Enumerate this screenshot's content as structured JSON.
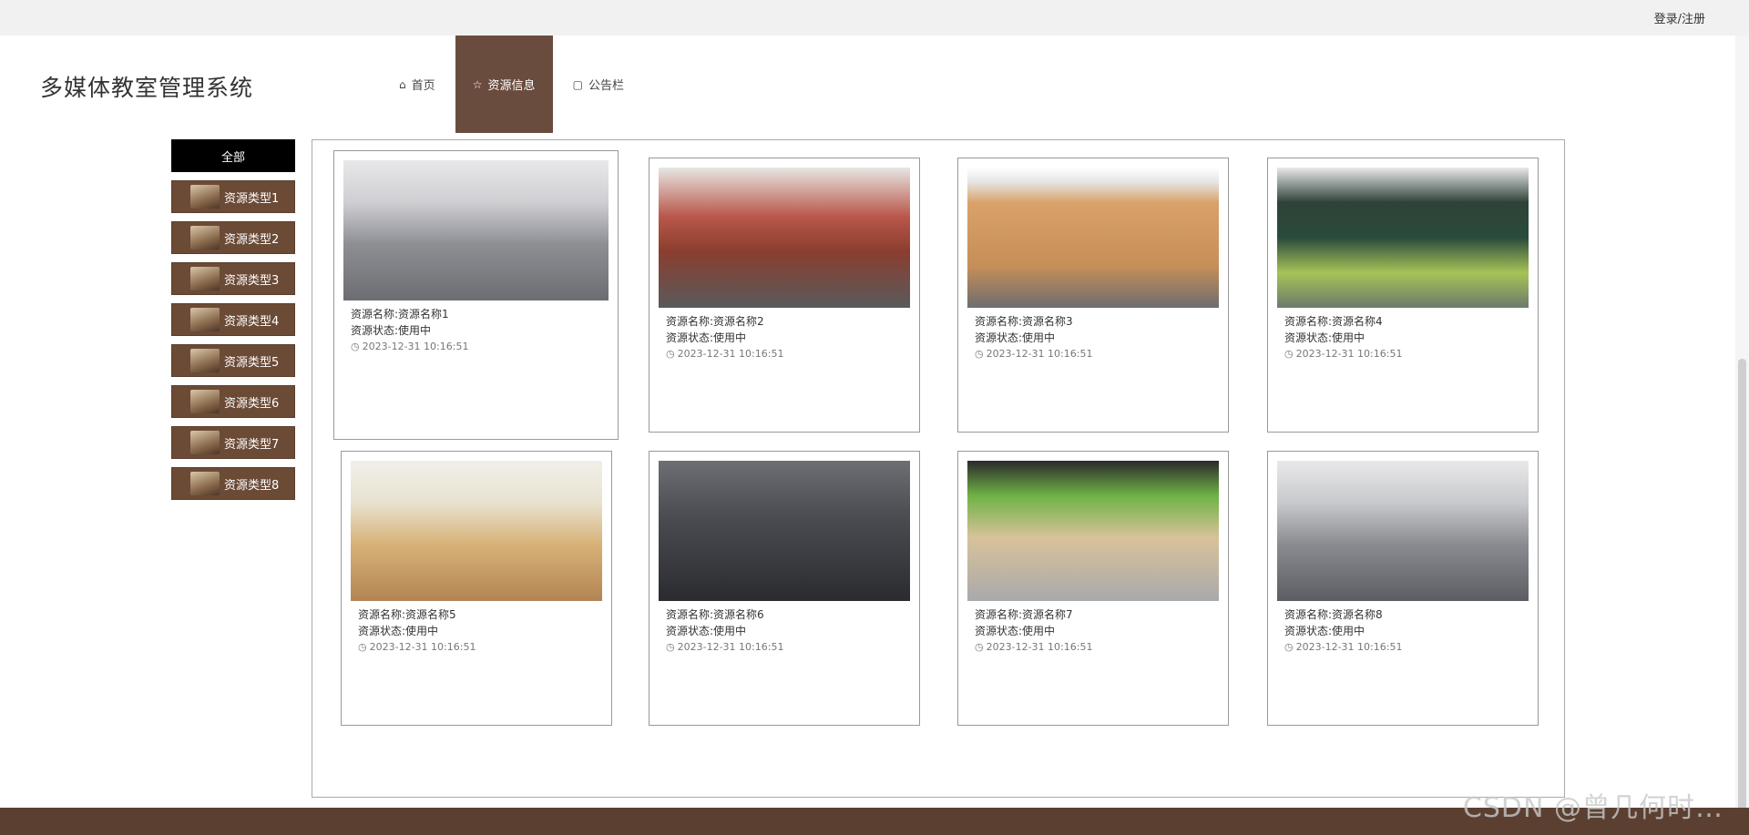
{
  "auth": {
    "label": "登录/注册"
  },
  "app": {
    "title": "多媒体教室管理系统"
  },
  "nav": [
    {
      "icon": "⌂",
      "label": "首页",
      "active": false
    },
    {
      "icon": "☆",
      "label": "资源信息",
      "active": true
    },
    {
      "icon": "▢",
      "label": "公告栏",
      "active": false
    }
  ],
  "categories": [
    {
      "label": "全部",
      "active": true
    },
    {
      "label": "资源类型1"
    },
    {
      "label": "资源类型2"
    },
    {
      "label": "资源类型3"
    },
    {
      "label": "资源类型4"
    },
    {
      "label": "资源类型5"
    },
    {
      "label": "资源类型6"
    },
    {
      "label": "资源类型7"
    },
    {
      "label": "资源类型8"
    }
  ],
  "resources": [
    {
      "name": "资源名称:资源名称1",
      "status": "资源状态:使用中",
      "time": "2023-12-31 10:16:51"
    },
    {
      "name": "资源名称:资源名称2",
      "status": "资源状态:使用中",
      "time": "2023-12-31 10:16:51"
    },
    {
      "name": "资源名称:资源名称3",
      "status": "资源状态:使用中",
      "time": "2023-12-31 10:16:51"
    },
    {
      "name": "资源名称:资源名称4",
      "status": "资源状态:使用中",
      "time": "2023-12-31 10:16:51"
    },
    {
      "name": "资源名称:资源名称5",
      "status": "资源状态:使用中",
      "time": "2023-12-31 10:16:51"
    },
    {
      "name": "资源名称:资源名称6",
      "status": "资源状态:使用中",
      "time": "2023-12-31 10:16:51"
    },
    {
      "name": "资源名称:资源名称7",
      "status": "资源状态:使用中",
      "time": "2023-12-31 10:16:51"
    },
    {
      "name": "资源名称:资源名称8",
      "status": "资源状态:使用中",
      "time": "2023-12-31 10:16:51"
    }
  ],
  "watermark": "CSDN @曾几何时…",
  "icons": {
    "home": "home-icon",
    "star": "star-icon",
    "notice": "notice-icon",
    "clock": "clock-icon"
  },
  "colors": {
    "accent": "#6a4c3e",
    "footer": "#5b4032",
    "active_category": "#000000"
  }
}
